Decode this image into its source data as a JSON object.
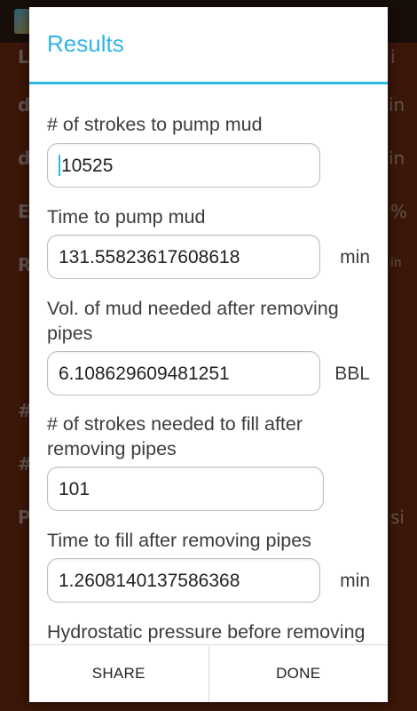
{
  "dialog": {
    "title": "Results",
    "fields": [
      {
        "label": "# of strokes to pump mud",
        "value": "10525",
        "unit": ""
      },
      {
        "label": "Time to pump mud",
        "value": "131.55823617608618",
        "unit": "min"
      },
      {
        "label": "Vol. of mud needed after removing pipes",
        "value": "6.108629609481251",
        "unit": "BBL"
      },
      {
        "label": "# of strokes needed to fill after removing pipes",
        "value": "101",
        "unit": ""
      },
      {
        "label": "Time to fill after removing pipes",
        "value": "1.2608140137586368",
        "unit": "min"
      },
      {
        "label": "Hydrostatic pressure before removing pipes"
      }
    ],
    "buttons": {
      "share": "SHARE",
      "done": "DONE"
    }
  },
  "background": {
    "rows": [
      {
        "left": "L",
        "right": "i"
      },
      {
        "left": "d",
        "right": "in"
      },
      {
        "left": "d",
        "right": "in"
      },
      {
        "left": "E",
        "right": "%"
      },
      {
        "left": "R",
        "right": "in"
      },
      {
        "left": "#",
        "right": ""
      },
      {
        "left": "#",
        "right": ""
      },
      {
        "left": "P",
        "right": "si"
      }
    ]
  }
}
